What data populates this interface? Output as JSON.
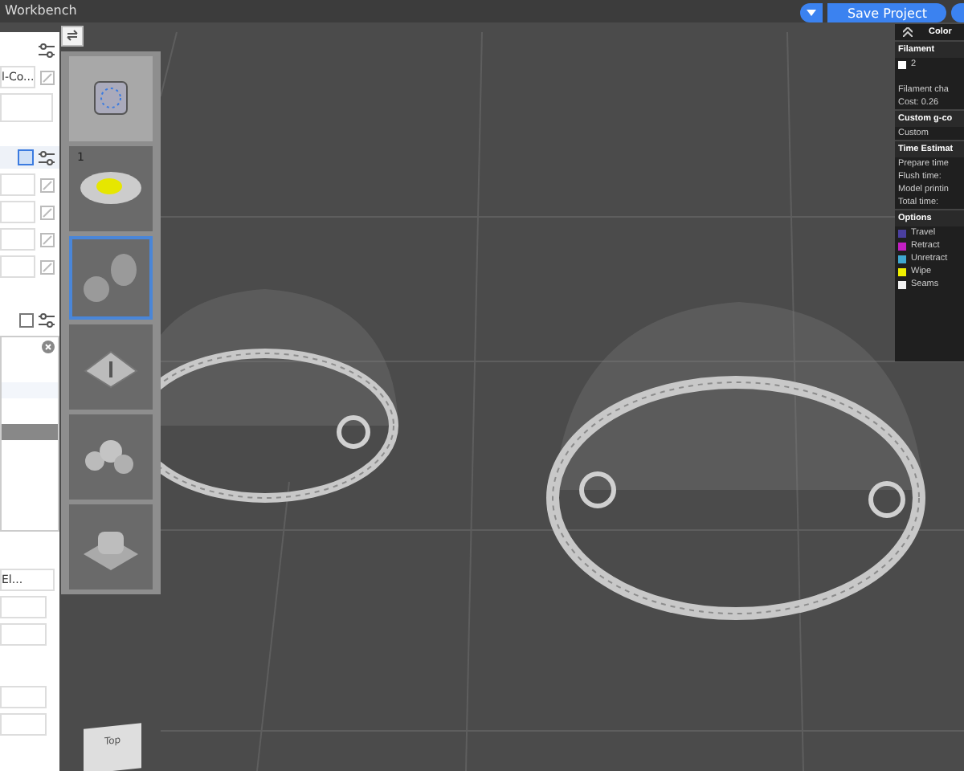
{
  "window": {
    "title": "Workbench"
  },
  "save_button": {
    "label": "Save Project"
  },
  "left_panel": {
    "preset_field": {
      "value": "l-Co..."
    },
    "list_rows": [
      {
        "selected": false
      },
      {
        "selected": true
      }
    ],
    "lower_field": {
      "value": "El..."
    }
  },
  "thumbnails": [
    {
      "kind": "cube",
      "selected": false
    },
    {
      "kind": "flower",
      "selected": false,
      "label": "1"
    },
    {
      "kind": "eggs",
      "selected": true
    },
    {
      "kind": "box",
      "selected": false
    },
    {
      "kind": "cluster",
      "selected": false
    },
    {
      "kind": "stack",
      "selected": false
    }
  ],
  "legend_panel": {
    "title": "Color",
    "filament_header": "Filament",
    "filament": "2",
    "filament_change": "Filament cha",
    "cost": "Cost:  0.26",
    "gcode_header": "Custom g-co",
    "gcode_value": "Custom",
    "time_header": "Time Estimat",
    "times": [
      "Prepare time",
      "Flush time:",
      "Model printin",
      "Total time:"
    ],
    "options_header": "Options",
    "options": [
      {
        "label": "Travel",
        "color": "#4a3fa0"
      },
      {
        "label": "Retract",
        "color": "#c21fc2"
      },
      {
        "label": "Unretract",
        "color": "#3fa8d0"
      },
      {
        "label": "Wipe",
        "color": "#f0f000"
      },
      {
        "label": "Seams",
        "color": "#f2f2f2"
      }
    ]
  },
  "view_cube": {
    "label": "Top"
  }
}
